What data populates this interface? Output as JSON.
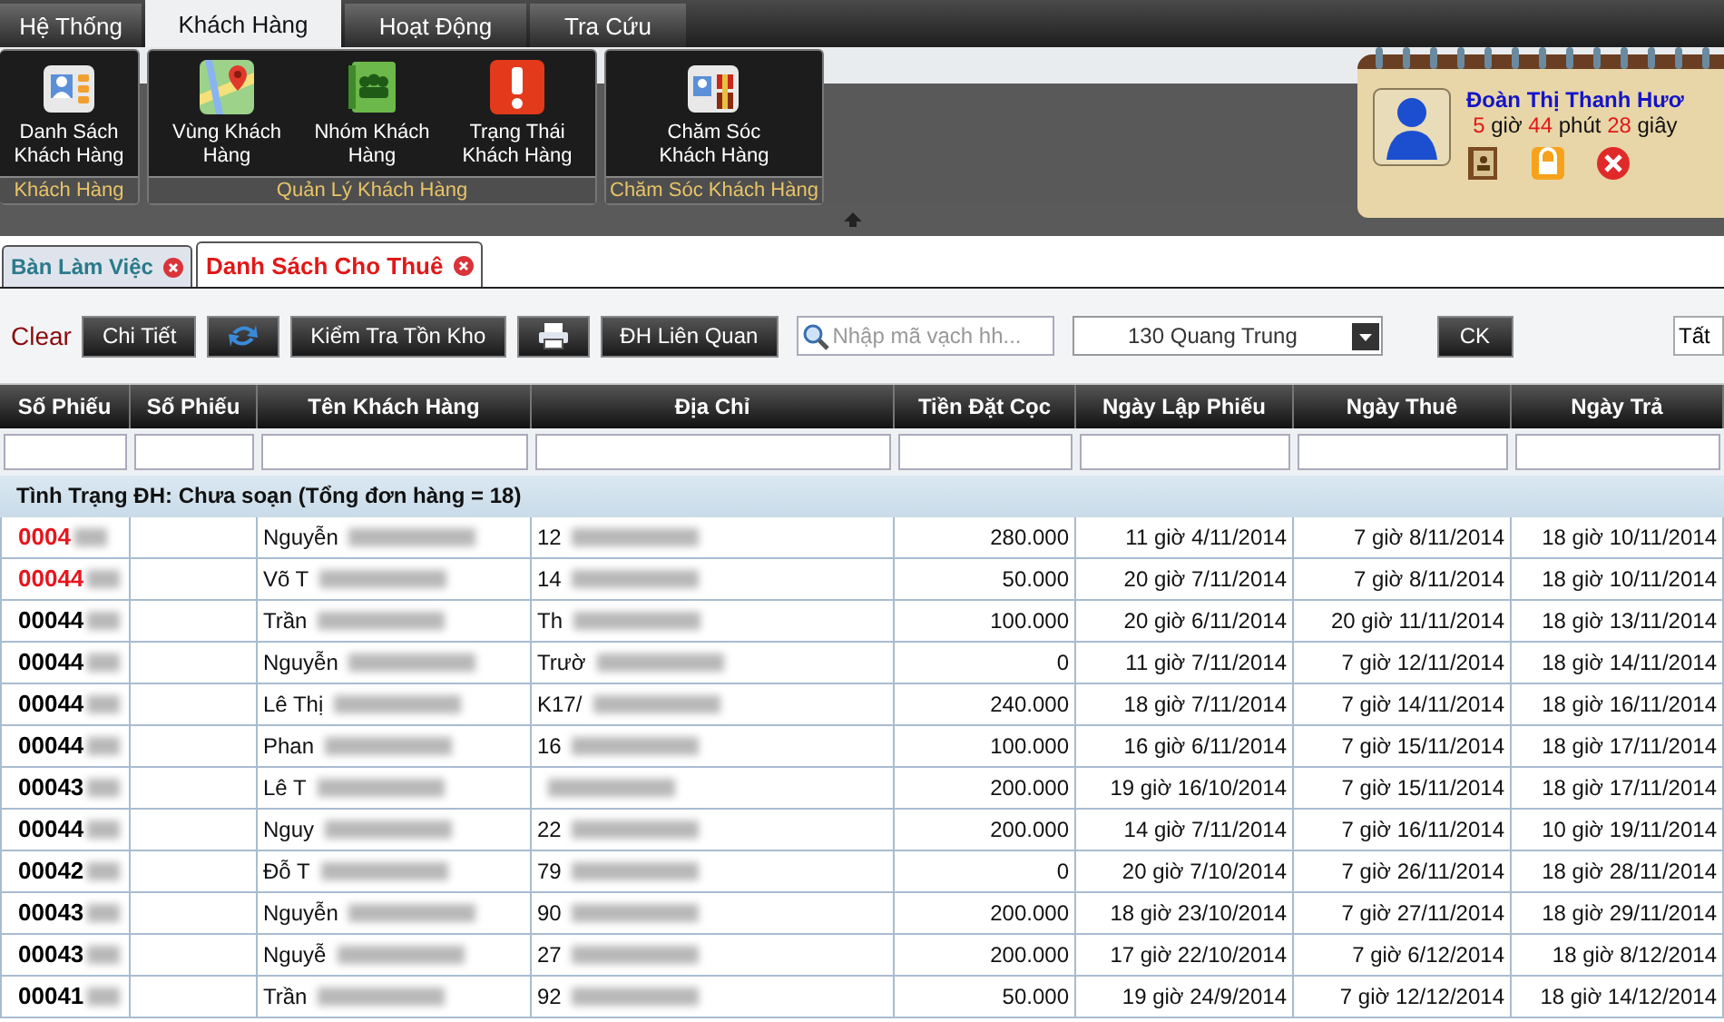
{
  "menu_tabs": [
    {
      "label": "Hệ Thống",
      "selected": false
    },
    {
      "label": "Khách Hàng",
      "selected": true
    },
    {
      "label": "Hoạt Động",
      "selected": false
    },
    {
      "label": "Tra Cứu",
      "selected": false
    }
  ],
  "ribbon_groups": [
    {
      "label": "Khách Hàng",
      "buttons": [
        {
          "label": "Danh Sách Khách Hàng"
        }
      ]
    },
    {
      "label": "Quản Lý Khách Hàng",
      "buttons": [
        {
          "label": "Vùng Khách Hàng"
        },
        {
          "label": "Nhóm Khách Hàng"
        },
        {
          "label": "Trạng Thái Khách Hàng"
        }
      ]
    },
    {
      "label": "Chăm Sóc Khách Hàng",
      "buttons": [
        {
          "label": "Chăm Sóc Khách Hàng"
        }
      ]
    }
  ],
  "user_card": {
    "name": "Đoàn Thị Thanh Hươ",
    "hours": "5",
    "hours_unit": "giờ",
    "minutes": "44",
    "minutes_unit": "phút",
    "seconds": "28",
    "seconds_unit": "giây"
  },
  "doc_tabs": [
    {
      "label": "Bàn Làm Việc",
      "selected": false
    },
    {
      "label": "Danh Sách Cho Thuê",
      "selected": true
    }
  ],
  "toolbar": {
    "clear": "Clear",
    "buttons": [
      {
        "kind": "text",
        "label": "Chi Tiết"
      },
      {
        "kind": "refresh"
      },
      {
        "kind": "text",
        "label": "Kiểm Tra Tồn Kho"
      },
      {
        "kind": "print"
      },
      {
        "kind": "text",
        "label": "ĐH Liên Quan"
      }
    ],
    "search": {
      "placeholder": "Nhập mã vạch hh..."
    },
    "branch": "130 Quang Trung",
    "ck": "CK",
    "filter": "Tất"
  },
  "table": {
    "columns": [
      "Số Phiếu",
      "Số Phiếu",
      "Tên Khách Hàng",
      "Địa Chỉ",
      "Tiền Đặt Cọc",
      "Ngày Lập Phiếu",
      "Ngày Thuê",
      "Ngày Trả"
    ],
    "group": "Tình Trạng ĐH: Chưa soạn (Tổng đơn hàng = 18)",
    "rows": [
      {
        "id": "0004",
        "color": "#e8141c",
        "name": "Nguyễn",
        "address": "12",
        "deposit": "280.000",
        "created": "11 giờ 4/11/2014",
        "rent": "7 giờ 8/11/2014",
        "return": "18 giờ 10/11/2014"
      },
      {
        "id": "00044",
        "color": "#e8141c",
        "name": "Võ T",
        "address": "14",
        "deposit": "50.000",
        "created": "20 giờ 7/11/2014",
        "rent": "7 giờ 8/11/2014",
        "return": "18 giờ 10/11/2014"
      },
      {
        "id": "00044",
        "color": "#000000",
        "name": "Trần",
        "address": "Th",
        "deposit": "100.000",
        "created": "20 giờ 6/11/2014",
        "rent": "20 giờ 11/11/2014",
        "return": "18 giờ 13/11/2014"
      },
      {
        "id": "00044",
        "color": "#000000",
        "name": "Nguyễn",
        "address": "Trườ",
        "deposit": "0",
        "created": "11 giờ 7/11/2014",
        "rent": "7 giờ 12/11/2014",
        "return": "18 giờ 14/11/2014"
      },
      {
        "id": "00044",
        "color": "#000000",
        "name": "Lê Thị",
        "address": "K17/",
        "deposit": "240.000",
        "created": "18 giờ 7/11/2014",
        "rent": "7 giờ 14/11/2014",
        "return": "18 giờ 16/11/2014"
      },
      {
        "id": "00044",
        "color": "#000000",
        "name": "Phan",
        "address": "16",
        "deposit": "100.000",
        "created": "16 giờ 6/11/2014",
        "rent": "7 giờ 15/11/2014",
        "return": "18 giờ 17/11/2014"
      },
      {
        "id": "00043",
        "color": "#000000",
        "name": "Lê T",
        "deposit": "200.000",
        "created": "19 giờ 16/10/2014",
        "rent": "7 giờ 15/11/2014",
        "return": "18 giờ 17/11/2014"
      },
      {
        "id": "00044",
        "color": "#000000",
        "name": "Nguy",
        "address": "22",
        "deposit": "200.000",
        "created": "14 giờ 7/11/2014",
        "rent": "7 giờ 16/11/2014",
        "return": "10 giờ 19/11/2014"
      },
      {
        "id": "00042",
        "color": "#000000",
        "name": "Đỗ T",
        "address": "79",
        "deposit": "0",
        "created": "20 giờ 7/10/2014",
        "rent": "7 giờ 26/11/2014",
        "return": "18 giờ 28/11/2014"
      },
      {
        "id": "00043",
        "color": "#000000",
        "name": "Nguyễn",
        "address": "90",
        "deposit": "200.000",
        "created": "18 giờ 23/10/2014",
        "rent": "7 giờ 27/11/2014",
        "return": "18 giờ 29/11/2014"
      },
      {
        "id": "00043",
        "color": "#000000",
        "name": "Nguyễ",
        "address": "27",
        "deposit": "200.000",
        "created": "17 giờ 22/10/2014",
        "rent": "7 giờ 6/12/2014",
        "return": "18 giờ 8/12/2014"
      },
      {
        "id": "00041",
        "color": "#000000",
        "name": "Trần",
        "address": "92",
        "deposit": "50.000",
        "created": "19 giờ 24/9/2014",
        "rent": "7 giờ 12/12/2014",
        "return": "18 giờ 14/12/2014"
      }
    ]
  }
}
